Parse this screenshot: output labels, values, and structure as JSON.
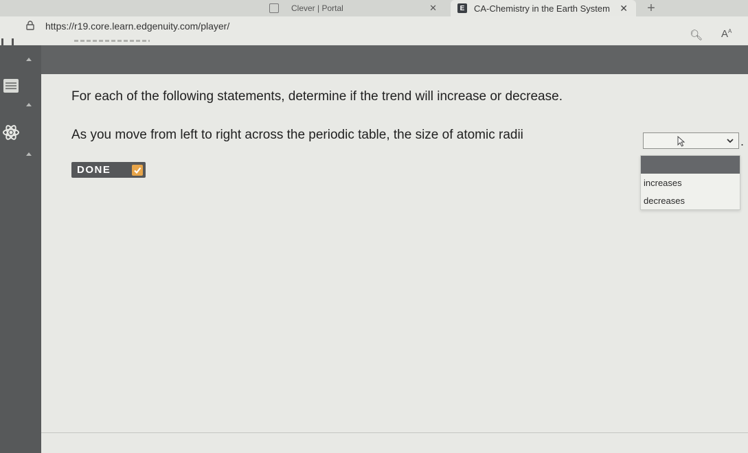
{
  "browser": {
    "tabs": [
      {
        "label": "Clever | Portal",
        "active": false
      },
      {
        "label": "CA-Chemistry in the Earth System",
        "active": true,
        "favicon_letter": "E"
      }
    ],
    "url": "https://r19.core.learn.edgenuity.com/player/"
  },
  "question": {
    "instructions": "For each of the following statements, determine if the trend will increase or decrease.",
    "statement": "As you move from left to right across the periodic table, the size of atomic radii",
    "punctuation": ".",
    "select": {
      "selected": "",
      "options": [
        "increases",
        "decreases"
      ]
    }
  },
  "done_button": {
    "label": "DONE"
  },
  "colors": {
    "sidebar": "#57595a",
    "topband": "#616364",
    "done_bg": "#555759",
    "done_check": "#e7a54a"
  }
}
